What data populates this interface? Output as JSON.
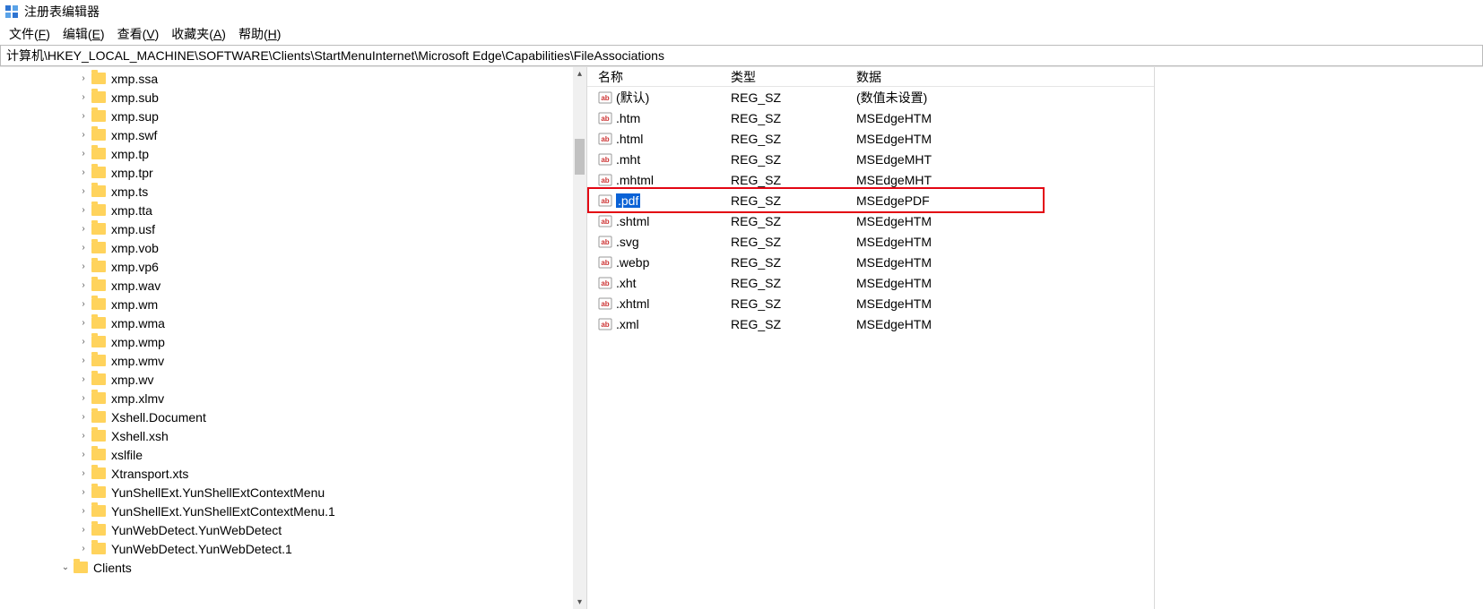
{
  "title": "注册表编辑器",
  "menu": {
    "file": "文件(",
    "file_u": "F",
    "file_after": ")",
    "edit": "编辑(",
    "edit_u": "E",
    "edit_after": ")",
    "view": "查看(",
    "view_u": "V",
    "view_after": ")",
    "fav": "收藏夹(",
    "fav_u": "A",
    "fav_after": ")",
    "help": "帮助(",
    "help_u": "H",
    "help_after": ")"
  },
  "address": "计算机\\HKEY_LOCAL_MACHINE\\SOFTWARE\\Clients\\StartMenuInternet\\Microsoft Edge\\Capabilities\\FileAssociations",
  "columns": {
    "name": "名称",
    "type": "类型",
    "data": "数据"
  },
  "tree": [
    {
      "indent": 4,
      "exp": ">",
      "label": "xmp.ssa"
    },
    {
      "indent": 4,
      "exp": ">",
      "label": "xmp.sub"
    },
    {
      "indent": 4,
      "exp": ">",
      "label": "xmp.sup"
    },
    {
      "indent": 4,
      "exp": ">",
      "label": "xmp.swf"
    },
    {
      "indent": 4,
      "exp": ">",
      "label": "xmp.tp"
    },
    {
      "indent": 4,
      "exp": ">",
      "label": "xmp.tpr"
    },
    {
      "indent": 4,
      "exp": ">",
      "label": "xmp.ts"
    },
    {
      "indent": 4,
      "exp": ">",
      "label": "xmp.tta"
    },
    {
      "indent": 4,
      "exp": ">",
      "label": "xmp.usf"
    },
    {
      "indent": 4,
      "exp": ">",
      "label": "xmp.vob"
    },
    {
      "indent": 4,
      "exp": ">",
      "label": "xmp.vp6"
    },
    {
      "indent": 4,
      "exp": ">",
      "label": "xmp.wav"
    },
    {
      "indent": 4,
      "exp": ">",
      "label": "xmp.wm"
    },
    {
      "indent": 4,
      "exp": ">",
      "label": "xmp.wma"
    },
    {
      "indent": 4,
      "exp": ">",
      "label": "xmp.wmp"
    },
    {
      "indent": 4,
      "exp": ">",
      "label": "xmp.wmv"
    },
    {
      "indent": 4,
      "exp": ">",
      "label": "xmp.wv"
    },
    {
      "indent": 4,
      "exp": ">",
      "label": "xmp.xlmv"
    },
    {
      "indent": 4,
      "exp": ">",
      "label": "Xshell.Document"
    },
    {
      "indent": 4,
      "exp": ">",
      "label": "Xshell.xsh"
    },
    {
      "indent": 4,
      "exp": ">",
      "label": "xslfile"
    },
    {
      "indent": 4,
      "exp": ">",
      "label": "Xtransport.xts"
    },
    {
      "indent": 4,
      "exp": ">",
      "label": "YunShellExt.YunShellExtContextMenu"
    },
    {
      "indent": 4,
      "exp": ">",
      "label": "YunShellExt.YunShellExtContextMenu.1"
    },
    {
      "indent": 4,
      "exp": ">",
      "label": "YunWebDetect.YunWebDetect"
    },
    {
      "indent": 4,
      "exp": ">",
      "label": "YunWebDetect.YunWebDetect.1"
    },
    {
      "indent": 3,
      "exp": "v",
      "label": "Clients"
    }
  ],
  "values": [
    {
      "name": "(默认)",
      "type": "REG_SZ",
      "data": "(数值未设置)",
      "selected": false
    },
    {
      "name": ".htm",
      "type": "REG_SZ",
      "data": "MSEdgeHTM",
      "selected": false
    },
    {
      "name": ".html",
      "type": "REG_SZ",
      "data": "MSEdgeHTM",
      "selected": false
    },
    {
      "name": ".mht",
      "type": "REG_SZ",
      "data": "MSEdgeMHT",
      "selected": false
    },
    {
      "name": ".mhtml",
      "type": "REG_SZ",
      "data": "MSEdgeMHT",
      "selected": false
    },
    {
      "name": ".pdf",
      "type": "REG_SZ",
      "data": "MSEdgePDF",
      "selected": true
    },
    {
      "name": ".shtml",
      "type": "REG_SZ",
      "data": "MSEdgeHTM",
      "selected": false
    },
    {
      "name": ".svg",
      "type": "REG_SZ",
      "data": "MSEdgeHTM",
      "selected": false
    },
    {
      "name": ".webp",
      "type": "REG_SZ",
      "data": "MSEdgeHTM",
      "selected": false
    },
    {
      "name": ".xht",
      "type": "REG_SZ",
      "data": "MSEdgeHTM",
      "selected": false
    },
    {
      "name": ".xhtml",
      "type": "REG_SZ",
      "data": "MSEdgeHTM",
      "selected": false
    },
    {
      "name": ".xml",
      "type": "REG_SZ",
      "data": "MSEdgeHTM",
      "selected": false
    }
  ],
  "highlight_row_index": 5
}
